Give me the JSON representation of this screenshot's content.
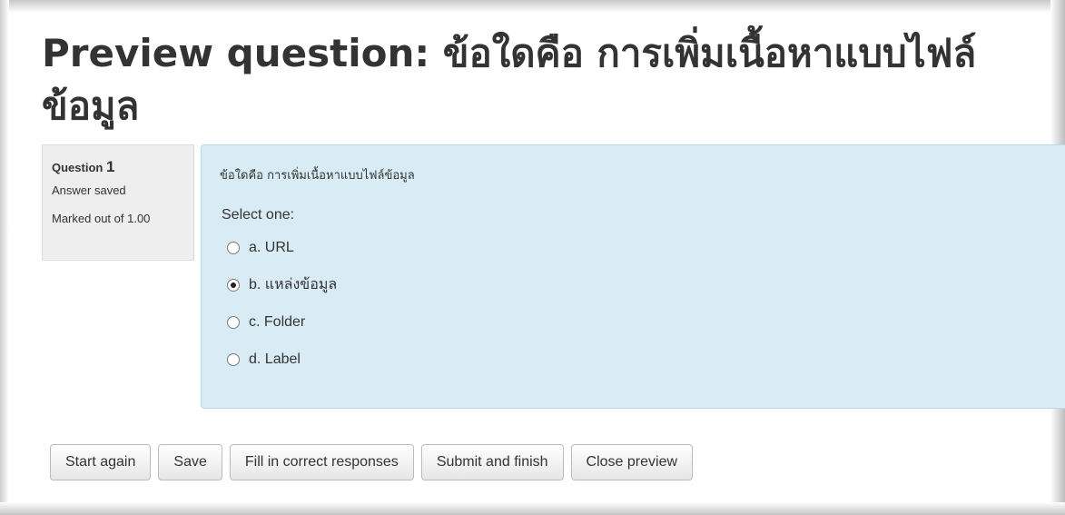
{
  "page": {
    "title": "Preview question: ข้อใดคือ การเพิ่มเนื้อหาแบบไฟล์ข้อมูล"
  },
  "info": {
    "question_label": "Question",
    "question_number": "1",
    "state": "Answer saved",
    "grade": "Marked out of 1.00"
  },
  "question": {
    "text": "ข้อใดคือ การเพิ่มเนื้อหาแบบไฟล์ข้อมูล",
    "prompt": "Select one:",
    "answers": [
      {
        "label": "a. URL",
        "checked": false
      },
      {
        "label": "b. แหล่งข้อมูล",
        "checked": true
      },
      {
        "label": "c. Folder",
        "checked": false
      },
      {
        "label": "d. Label",
        "checked": false
      }
    ]
  },
  "buttons": {
    "start_again": "Start again",
    "save": "Save",
    "fill_correct": "Fill in correct responses",
    "submit_finish": "Submit and finish",
    "close_preview": "Close preview"
  }
}
